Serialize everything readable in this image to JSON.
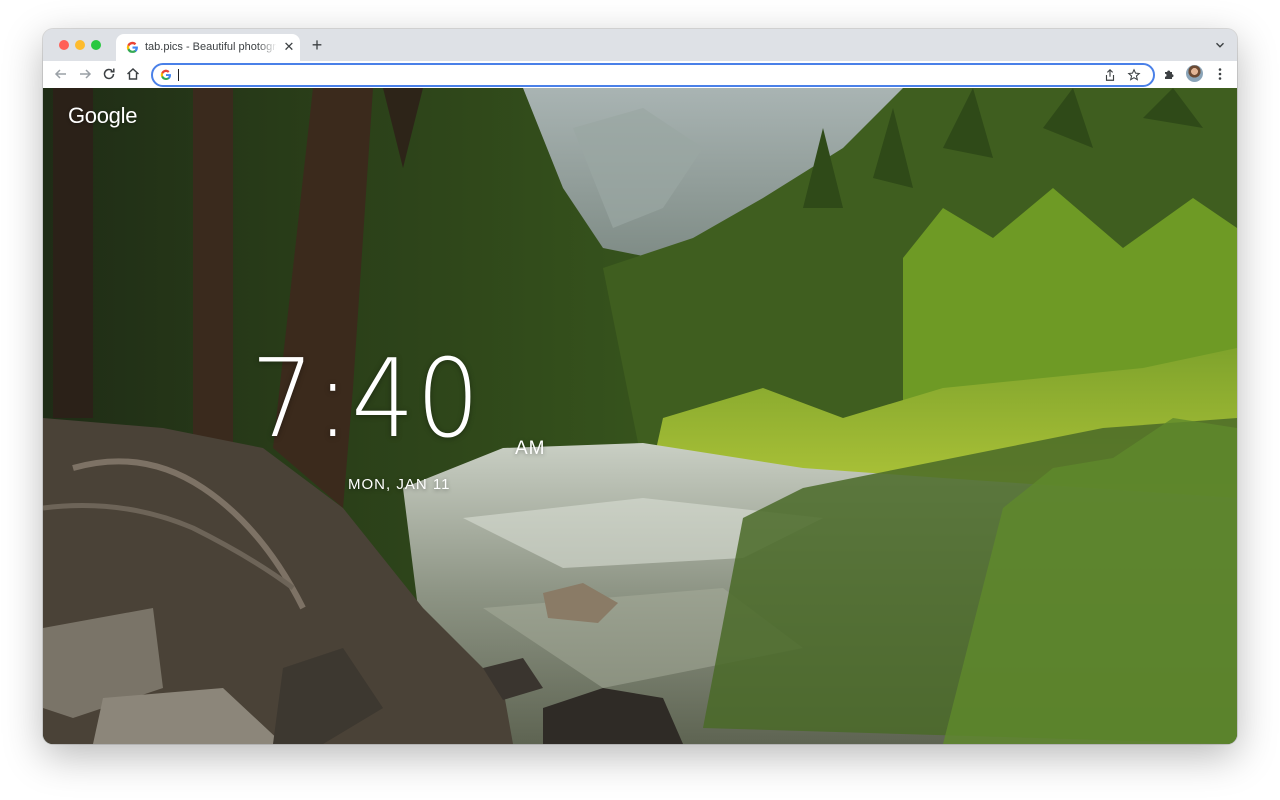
{
  "browser": {
    "tab": {
      "title": "tab.pics - Beautiful photographs",
      "favicon": "google-g-icon"
    },
    "new_tab_icon": "plus-icon",
    "tab_search_icon": "chevron-down-icon",
    "toolbar": {
      "back_icon": "arrow-left-icon",
      "forward_icon": "arrow-right-icon",
      "reload_icon": "reload-icon",
      "home_icon": "home-icon",
      "extensions_icon": "puzzle-icon",
      "menu_icon": "more-vert-icon"
    },
    "omnibox": {
      "value": "",
      "placeholder": "",
      "left_icon": "google-g-icon",
      "share_icon": "share-icon",
      "bookmark_icon": "star-icon"
    }
  },
  "page": {
    "logo_text": "Google",
    "clock": {
      "time": "7:40",
      "ampm": "AM",
      "date": "MON, JAN 11"
    },
    "background": "photo of a river flowing through a forested valley with granite cliffs"
  },
  "colors": {
    "omnibox_focus": "#4a80e8",
    "tab_strip": "#dee1e6",
    "traffic_red": "#ff5f57",
    "traffic_yellow": "#febc2e",
    "traffic_green": "#28c840"
  }
}
